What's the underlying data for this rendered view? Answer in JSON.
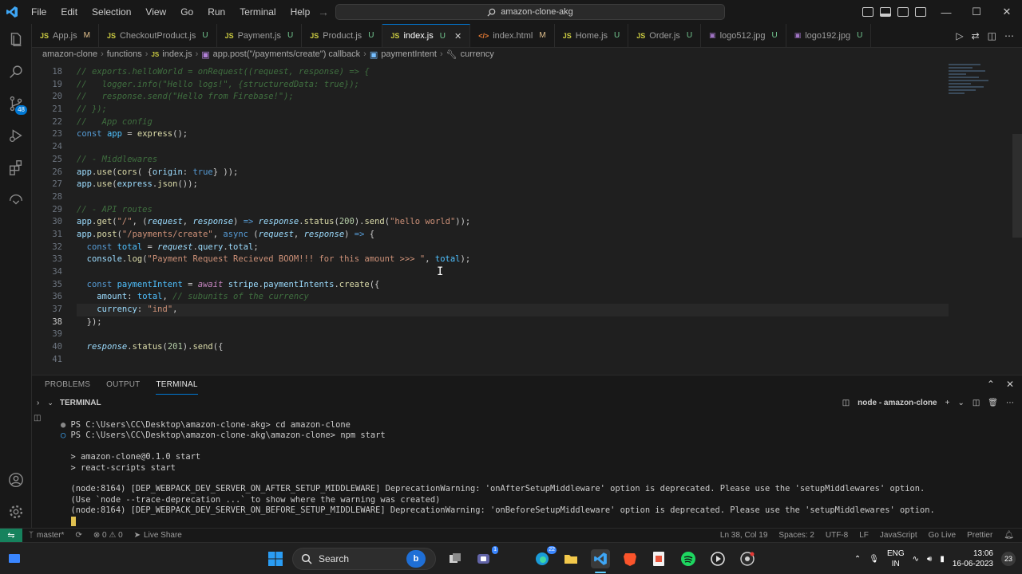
{
  "menu": [
    "File",
    "Edit",
    "Selection",
    "View",
    "Go",
    "Run",
    "Terminal",
    "Help"
  ],
  "command_center": "amazon-clone-akg",
  "tabs": [
    {
      "label": "App.js",
      "status": "M",
      "type": "js"
    },
    {
      "label": "CheckoutProduct.js",
      "status": "U",
      "type": "js"
    },
    {
      "label": "Payment.js",
      "status": "U",
      "type": "js"
    },
    {
      "label": "Product.js",
      "status": "U",
      "type": "js"
    },
    {
      "label": "index.js",
      "status": "U",
      "type": "js",
      "active": true
    },
    {
      "label": "index.html",
      "status": "M",
      "type": "html"
    },
    {
      "label": "Home.js",
      "status": "U",
      "type": "js"
    },
    {
      "label": "Order.js",
      "status": "U",
      "type": "js"
    },
    {
      "label": "logo512.jpg",
      "status": "U",
      "type": "img"
    },
    {
      "label": "logo192.jpg",
      "status": "U",
      "type": "img"
    }
  ],
  "breadcrumb": [
    "amazon-clone",
    "functions",
    "index.js",
    "app.post(\"/payments/create\") callback",
    "paymentIntent",
    "currency"
  ],
  "line_numbers": [
    "18",
    "19",
    "20",
    "21",
    "22",
    "23",
    "24",
    "25",
    "26",
    "27",
    "28",
    "29",
    "30",
    "31",
    "32",
    "33",
    "34",
    "35",
    "36",
    "37",
    "38",
    "39",
    "40",
    "41"
  ],
  "current_line": "38",
  "terminal_tabs": [
    "PROBLEMS",
    "OUTPUT",
    "TERMINAL"
  ],
  "terminal_label": "TERMINAL",
  "terminal_instance": "node - amazon-clone",
  "terminal_lines": [
    "PS C:\\Users\\CC\\Desktop\\amazon-clone-akg> cd amazon-clone",
    "PS C:\\Users\\CC\\Desktop\\amazon-clone-akg\\amazon-clone> npm start",
    "",
    "> amazon-clone@0.1.0 start",
    "> react-scripts start",
    "",
    "(node:8164) [DEP_WEBPACK_DEV_SERVER_ON_AFTER_SETUP_MIDDLEWARE] DeprecationWarning: 'onAfterSetupMiddleware' option is deprecated. Please use the 'setupMiddlewares' option.",
    "(Use `node --trace-deprecation ...` to show where the warning was created)",
    "(node:8164) [DEP_WEBPACK_DEV_SERVER_ON_BEFORE_SETUP_MIDDLEWARE] DeprecationWarning: 'onBeforeSetupMiddleware' option is deprecated. Please use the 'setupMiddlewares' option."
  ],
  "status": {
    "branch": "master*",
    "problems": "⊗ 0 ⚠ 0",
    "live_share": "Live Share",
    "position": "Ln 38, Col 19",
    "spaces": "Spaces: 2",
    "encoding": "UTF-8",
    "eol": "LF",
    "language": "JavaScript",
    "go_live": "Go Live",
    "prettier": "Prettier"
  },
  "taskbar": {
    "search": "Search",
    "lang1": "ENG",
    "lang2": "IN",
    "time": "13:06",
    "date": "16-06-2023",
    "teams_badge": "1",
    "edge_badge": "22",
    "notif_count": "23"
  },
  "badges": {
    "source_control": "48"
  }
}
